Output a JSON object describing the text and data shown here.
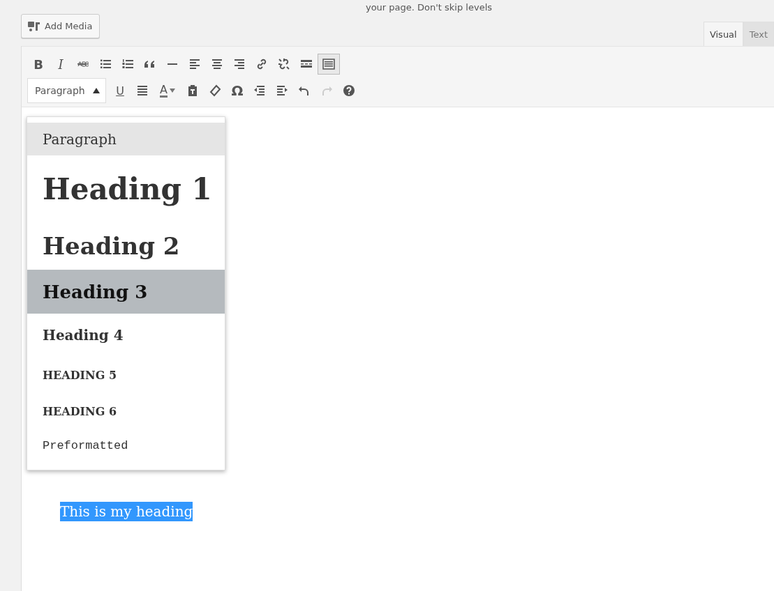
{
  "caption": "your page. Don't skip levels",
  "add_media": {
    "label": "Add Media"
  },
  "tabs": [
    {
      "label": "Visual",
      "selected": true
    },
    {
      "label": "Text",
      "selected": false
    }
  ],
  "toolbar_rows": [
    [
      {
        "kind": "bold",
        "label": "B",
        "pressed": false,
        "disabled": false
      },
      {
        "kind": "italic",
        "label": "I",
        "pressed": false,
        "disabled": false
      },
      {
        "kind": "strikethrough",
        "pressed": false,
        "disabled": false
      },
      {
        "kind": "bullet-list",
        "pressed": false,
        "disabled": false
      },
      {
        "kind": "numbered-list",
        "pressed": false,
        "disabled": false
      },
      {
        "kind": "blockquote",
        "pressed": false,
        "disabled": false
      },
      {
        "kind": "horizontal-line",
        "pressed": false,
        "disabled": false
      },
      {
        "kind": "align-left",
        "pressed": false,
        "disabled": false
      },
      {
        "kind": "align-center",
        "pressed": false,
        "disabled": false
      },
      {
        "kind": "align-right",
        "pressed": false,
        "disabled": false
      },
      {
        "kind": "link",
        "pressed": false,
        "disabled": false
      },
      {
        "kind": "unlink",
        "pressed": false,
        "disabled": false
      },
      {
        "kind": "read-more",
        "pressed": false,
        "disabled": false
      },
      {
        "kind": "toolbar-toggle",
        "pressed": true,
        "disabled": false
      }
    ],
    [
      {
        "kind": "format-select",
        "label": "Paragraph",
        "pressed": true,
        "disabled": false
      },
      {
        "kind": "underline",
        "label": "U",
        "pressed": false,
        "disabled": false
      },
      {
        "kind": "justify",
        "pressed": false,
        "disabled": false
      },
      {
        "kind": "text-color",
        "label": "A",
        "pressed": false,
        "disabled": false
      },
      {
        "kind": "paste-text",
        "pressed": false,
        "disabled": false
      },
      {
        "kind": "clear-formatting",
        "pressed": false,
        "disabled": false
      },
      {
        "kind": "special-character",
        "label": "Ω",
        "pressed": false,
        "disabled": false
      },
      {
        "kind": "outdent",
        "pressed": false,
        "disabled": false
      },
      {
        "kind": "indent",
        "pressed": false,
        "disabled": false
      },
      {
        "kind": "undo",
        "pressed": false,
        "disabled": false
      },
      {
        "kind": "redo",
        "pressed": false,
        "disabled": true
      },
      {
        "kind": "help",
        "pressed": false,
        "disabled": false
      }
    ]
  ],
  "format_menu": [
    {
      "kind": "paragraph",
      "label": "Paragraph",
      "highlighted": true,
      "selected": false
    },
    {
      "kind": "h1",
      "label": "Heading 1",
      "highlighted": false,
      "selected": false
    },
    {
      "kind": "h2",
      "label": "Heading 2",
      "highlighted": false,
      "selected": false
    },
    {
      "kind": "h3",
      "label": "Heading 3",
      "highlighted": false,
      "selected": true
    },
    {
      "kind": "h4",
      "label": "Heading 4",
      "highlighted": false,
      "selected": false
    },
    {
      "kind": "h5",
      "label": "HEADING 5",
      "highlighted": false,
      "selected": false
    },
    {
      "kind": "h6",
      "label": "HEADING 6",
      "highlighted": false,
      "selected": false
    },
    {
      "kind": "pre",
      "label": "Preformatted",
      "highlighted": false,
      "selected": false
    }
  ],
  "content": {
    "text": "This is my heading",
    "selected": true
  }
}
